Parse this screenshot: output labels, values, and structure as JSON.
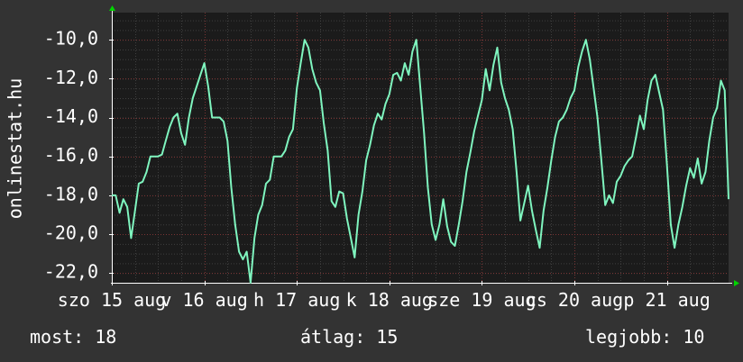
{
  "colors": {
    "background": "#333333",
    "plot_background": "#1b1b1b",
    "grid_minor": "#3f3f3f",
    "grid_major": "#7a3434",
    "axis": "#ffffff",
    "arrow": "#00d400",
    "line": "#7ff5bf",
    "text": "#ffffff"
  },
  "chart_data": {
    "type": "line",
    "ylabel": "onlinestat.hu",
    "ylim": [
      -22.5,
      -8.6
    ],
    "y_ticks": [
      -22,
      -20,
      -18,
      -16,
      -14,
      -12,
      -10
    ],
    "y_tick_labels": [
      "-22,0",
      "-20,0",
      "-18,0",
      "-16,0",
      "-14,0",
      "-12,0",
      "-10,0"
    ],
    "xlim": [
      0,
      160
    ],
    "x_tick_positions": [
      0,
      24,
      48,
      72,
      96,
      120,
      144
    ],
    "x_tick_labels": [
      "szo 15 aug",
      "v 16 aug",
      "h 17 aug",
      "k 18 aug",
      "sze 19 aug",
      "cs 20 aug",
      "p 21 aug"
    ],
    "grid": true,
    "series": [
      {
        "values": [
          [
            0,
            -18
          ],
          [
            1,
            -18
          ],
          [
            2,
            -18.9
          ],
          [
            3,
            -18.2
          ],
          [
            4,
            -18.6
          ],
          [
            5,
            -20.2
          ],
          [
            6,
            -18.8
          ],
          [
            7,
            -17.4
          ],
          [
            8,
            -17.3
          ],
          [
            9,
            -16.8
          ],
          [
            10,
            -16
          ],
          [
            11,
            -16
          ],
          [
            12,
            -16
          ],
          [
            13,
            -15.9
          ],
          [
            14,
            -15.2
          ],
          [
            15,
            -14.5
          ],
          [
            16,
            -14
          ],
          [
            17,
            -13.8
          ],
          [
            18,
            -14.8
          ],
          [
            19,
            -15.4
          ],
          [
            20,
            -14
          ],
          [
            21,
            -13
          ],
          [
            22,
            -12.4
          ],
          [
            23,
            -11.8
          ],
          [
            24,
            -11.2
          ],
          [
            25,
            -12.4
          ],
          [
            26,
            -14
          ],
          [
            27,
            -14
          ],
          [
            28,
            -14
          ],
          [
            29,
            -14.2
          ],
          [
            30,
            -15.2
          ],
          [
            31,
            -17.6
          ],
          [
            32,
            -19.5
          ],
          [
            33,
            -20.9
          ],
          [
            34,
            -21.3
          ],
          [
            35,
            -20.9
          ],
          [
            36,
            -22.5
          ],
          [
            37,
            -20.2
          ],
          [
            38,
            -19
          ],
          [
            39,
            -18.5
          ],
          [
            40,
            -17.4
          ],
          [
            41,
            -17.2
          ],
          [
            42,
            -16
          ],
          [
            43,
            -16
          ],
          [
            44,
            -16
          ],
          [
            45,
            -15.7
          ],
          [
            46,
            -15
          ],
          [
            47,
            -14.6
          ],
          [
            48,
            -12.5
          ],
          [
            49,
            -11.2
          ],
          [
            50,
            -10
          ],
          [
            51,
            -10.4
          ],
          [
            52,
            -11.5
          ],
          [
            53,
            -12.2
          ],
          [
            54,
            -12.6
          ],
          [
            55,
            -14.3
          ],
          [
            56,
            -15.7
          ],
          [
            57,
            -18.3
          ],
          [
            58,
            -18.6
          ],
          [
            59,
            -17.8
          ],
          [
            60,
            -17.9
          ],
          [
            61,
            -19.2
          ],
          [
            62,
            -20.2
          ],
          [
            63,
            -21.2
          ],
          [
            64,
            -19
          ],
          [
            65,
            -17.8
          ],
          [
            66,
            -16.2
          ],
          [
            67,
            -15.4
          ],
          [
            68,
            -14.4
          ],
          [
            69,
            -13.8
          ],
          [
            70,
            -14.1
          ],
          [
            71,
            -13.3
          ],
          [
            72,
            -12.8
          ],
          [
            73,
            -11.8
          ],
          [
            74,
            -11.7
          ],
          [
            75,
            -12.1
          ],
          [
            76,
            -11.2
          ],
          [
            77,
            -11.8
          ],
          [
            78,
            -10.6
          ],
          [
            79,
            -10
          ],
          [
            80,
            -12.4
          ],
          [
            81,
            -14.8
          ],
          [
            82,
            -17.6
          ],
          [
            83,
            -19.5
          ],
          [
            84,
            -20.3
          ],
          [
            85,
            -19.5
          ],
          [
            86,
            -18.2
          ],
          [
            87,
            -19.6
          ],
          [
            88,
            -20.4
          ],
          [
            89,
            -20.6
          ],
          [
            90,
            -19.5
          ],
          [
            91,
            -18.3
          ],
          [
            92,
            -16.8
          ],
          [
            93,
            -15.8
          ],
          [
            94,
            -14.7
          ],
          [
            95,
            -13.9
          ],
          [
            96,
            -13.1
          ],
          [
            97,
            -11.5
          ],
          [
            98,
            -12.6
          ],
          [
            99,
            -11.3
          ],
          [
            100,
            -10.4
          ],
          [
            101,
            -12.2
          ],
          [
            102,
            -13
          ],
          [
            103,
            -13.6
          ],
          [
            104,
            -14.6
          ],
          [
            105,
            -16.8
          ],
          [
            106,
            -19.3
          ],
          [
            107,
            -18.4
          ],
          [
            108,
            -17.5
          ],
          [
            109,
            -18.8
          ],
          [
            110,
            -19.8
          ],
          [
            111,
            -20.7
          ],
          [
            112,
            -18.8
          ],
          [
            113,
            -17.6
          ],
          [
            114,
            -16.2
          ],
          [
            115,
            -15
          ],
          [
            116,
            -14.2
          ],
          [
            117,
            -14
          ],
          [
            118,
            -13.6
          ],
          [
            119,
            -13
          ],
          [
            120,
            -12.6
          ],
          [
            121,
            -11.4
          ],
          [
            122,
            -10.6
          ],
          [
            123,
            -10
          ],
          [
            124,
            -11
          ],
          [
            125,
            -12.5
          ],
          [
            126,
            -14
          ],
          [
            127,
            -16.2
          ],
          [
            128,
            -18.5
          ],
          [
            129,
            -18
          ],
          [
            130,
            -18.4
          ],
          [
            131,
            -17.3
          ],
          [
            132,
            -17
          ],
          [
            133,
            -16.5
          ],
          [
            134,
            -16.2
          ],
          [
            135,
            -16
          ],
          [
            136,
            -15
          ],
          [
            137,
            -13.9
          ],
          [
            138,
            -14.6
          ],
          [
            139,
            -13.1
          ],
          [
            140,
            -12.1
          ],
          [
            141,
            -11.8
          ],
          [
            142,
            -12.7
          ],
          [
            143,
            -13.6
          ],
          [
            144,
            -16.4
          ],
          [
            145,
            -19.5
          ],
          [
            146,
            -20.7
          ],
          [
            147,
            -19.5
          ],
          [
            148,
            -18.6
          ],
          [
            149,
            -17.5
          ],
          [
            150,
            -16.6
          ],
          [
            151,
            -17.1
          ],
          [
            152,
            -16.1
          ],
          [
            153,
            -17.4
          ],
          [
            154,
            -16.8
          ],
          [
            155,
            -15.2
          ],
          [
            156,
            -14
          ],
          [
            157,
            -13.5
          ],
          [
            158,
            -12.1
          ],
          [
            159,
            -12.6
          ],
          [
            160,
            -18.2
          ]
        ]
      }
    ]
  },
  "footer": {
    "current": "most: 18",
    "average": "átlag: 15",
    "best": "legjobb: 10"
  }
}
